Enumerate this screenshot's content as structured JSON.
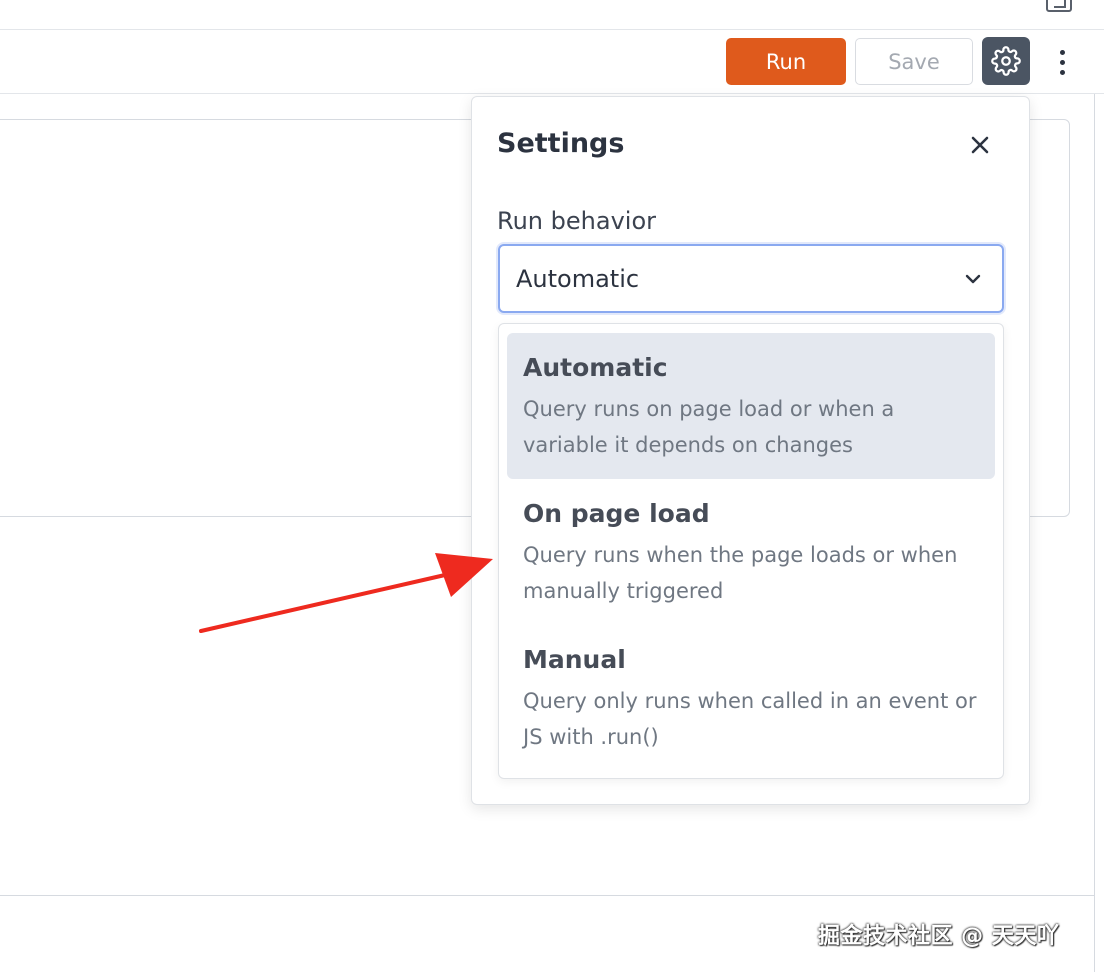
{
  "toolbar": {
    "run_label": "Run",
    "save_label": "Save"
  },
  "settings": {
    "title": "Settings",
    "run_behavior_label": "Run behavior",
    "selected_value": "Automatic",
    "options": [
      {
        "title": "Automatic",
        "description": "Query runs on page load or when a variable it depends on changes",
        "selected": true
      },
      {
        "title": "On page load",
        "description": "Query runs when the page loads or when manually triggered",
        "selected": false
      },
      {
        "title": "Manual",
        "description": "Query only runs when called in an event or JS with .run()",
        "selected": false
      }
    ]
  },
  "colors": {
    "run_button": "#df5a1c",
    "gear_button": "#4b5563",
    "focus_border": "#8aa9f0",
    "selected_option_bg": "#e4e8ef",
    "annotation_arrow": "#ee2a1f"
  },
  "icons": {
    "gear": "gear-icon",
    "more": "more-vertical-icon",
    "close": "close-icon",
    "chevron": "chevron-down-icon",
    "expand": "expand-icon"
  },
  "watermark": "掘金技术社区 @ 天天吖"
}
